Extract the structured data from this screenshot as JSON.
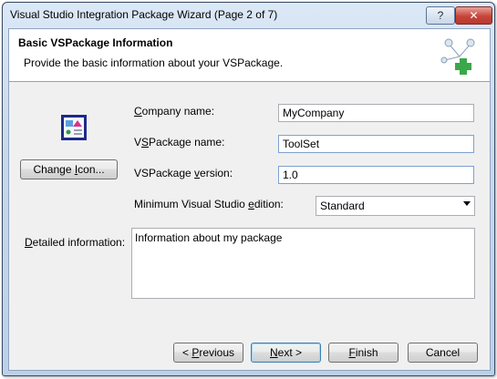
{
  "window": {
    "title": "Visual Studio Integration Package Wizard (Page 2 of 7)",
    "help_label": "?",
    "close_label": "✕"
  },
  "header": {
    "title": "Basic VSPackage Information",
    "subtitle": "Provide the basic information about your VSPackage.",
    "icon": "package-add-icon"
  },
  "form": {
    "package_icon": "vspackage-icon",
    "change_icon": {
      "pre": "Change ",
      "accel": "I",
      "post": "con..."
    },
    "company": {
      "label_accel": "C",
      "label_rest": "ompany name:",
      "value": "MyCompany"
    },
    "vspackage_name": {
      "label_pre": "V",
      "label_accel": "S",
      "label_rest": "Package name:",
      "value": "ToolSet"
    },
    "vspackage_version": {
      "label_pre": "VSPackage ",
      "label_accel": "v",
      "label_rest": "ersion:",
      "value": "1.0"
    },
    "min_edition": {
      "label_pre": "Minimum Visual Studio ",
      "label_accel": "e",
      "label_rest": "dition:",
      "value": "Standard"
    },
    "detailed": {
      "label_pre": "",
      "label_accel": "D",
      "label_rest": "etailed information:",
      "value": "Information about my package"
    }
  },
  "buttons": {
    "previous": {
      "pre": "< ",
      "accel": "P",
      "post": "revious"
    },
    "next": {
      "pre": "",
      "accel": "N",
      "post": "ext >"
    },
    "finish": {
      "pre": "",
      "accel": "F",
      "post": "inish"
    },
    "cancel": {
      "pre": "Cancel",
      "accel": "",
      "post": ""
    }
  },
  "colors": {
    "close": "#c7443a",
    "accent": "#3c7fb1",
    "icon_green": "#3aa84a"
  }
}
